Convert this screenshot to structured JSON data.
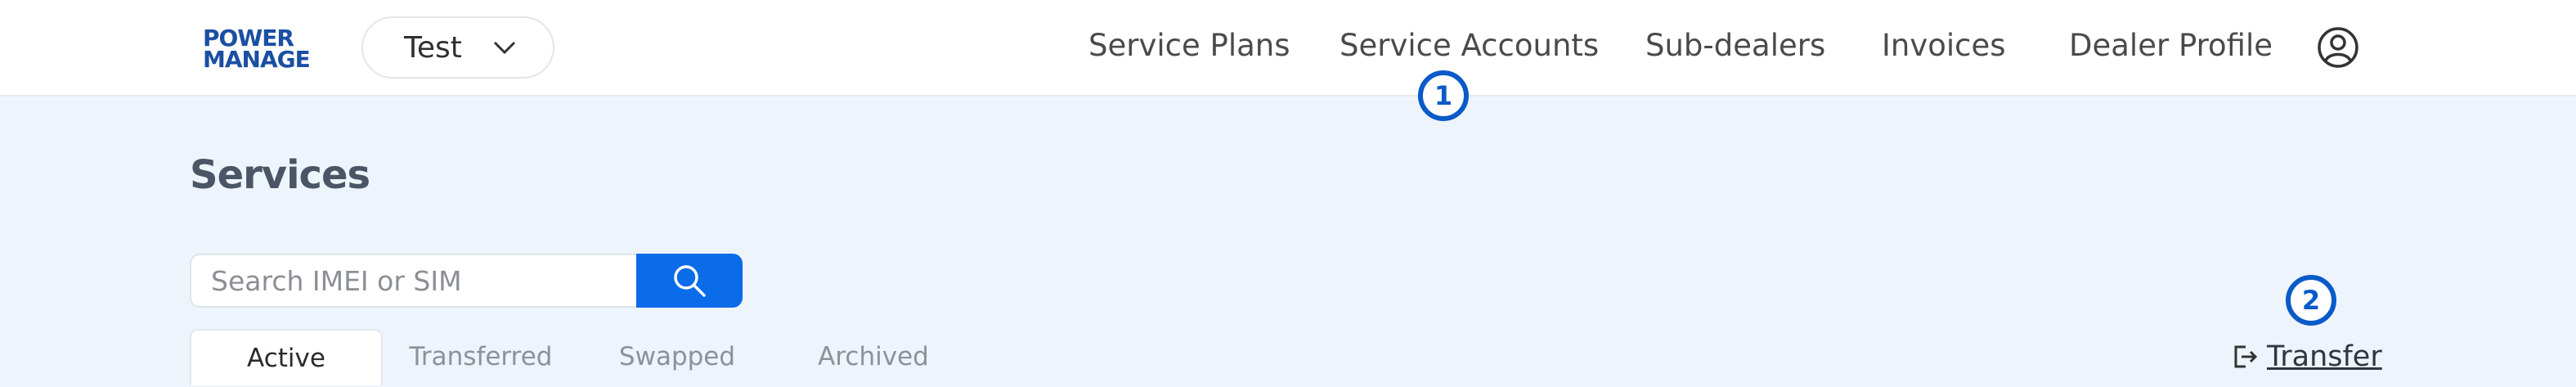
{
  "logo": {
    "line1": "POWER",
    "line2": "MANAGE"
  },
  "project_select": {
    "value": "Test"
  },
  "nav": {
    "items": [
      {
        "label": "Service Plans"
      },
      {
        "label": "Service Accounts"
      },
      {
        "label": "Sub-dealers"
      },
      {
        "label": "Invoices"
      },
      {
        "label": "Dealer Profile"
      }
    ],
    "user_icon": "user-circle-icon"
  },
  "annotations": [
    {
      "label": "1"
    },
    {
      "label": "2"
    }
  ],
  "page": {
    "title": "Services"
  },
  "search": {
    "placeholder": "Search IMEI or SIM",
    "value": ""
  },
  "tabs": [
    {
      "label": "Active",
      "active": true
    },
    {
      "label": "Transferred",
      "active": false
    },
    {
      "label": "Swapped",
      "active": false
    },
    {
      "label": "Archived",
      "active": false
    }
  ],
  "transfer": {
    "label": "Transfer",
    "icon": "transfer-exit-icon"
  },
  "colors": {
    "accent": "#0a6ce8",
    "badge": "#0a5ac8",
    "background": "#eef4fb",
    "logo": "#1a4fa3"
  }
}
